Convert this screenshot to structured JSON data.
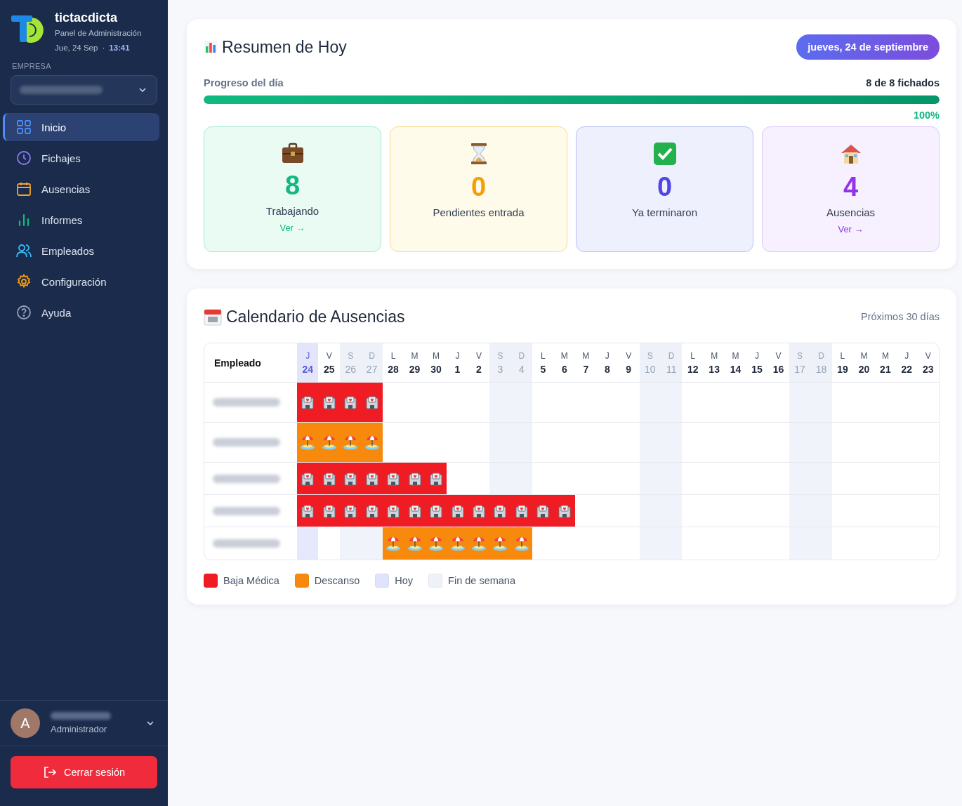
{
  "sidebar": {
    "brand": {
      "name": "tictacdicta",
      "subtitle": "Panel de Administración",
      "date": "Jue, 24 Sep",
      "separator": "·",
      "time": "13:41"
    },
    "company_label": "EMPRESA",
    "nav": [
      {
        "label": "Inicio",
        "selected": true
      },
      {
        "label": "Fichajes",
        "selected": false
      },
      {
        "label": "Ausencias",
        "selected": false
      },
      {
        "label": "Informes",
        "selected": false
      },
      {
        "label": "Empleados",
        "selected": false
      },
      {
        "label": "Configuración",
        "selected": false
      },
      {
        "label": "Ayuda",
        "selected": false
      }
    ],
    "user": {
      "initial": "A",
      "role": "Administrador"
    },
    "logout": "Cerrar sesión"
  },
  "summary": {
    "title": "Resumen de Hoy",
    "date_badge": "jueves, 24 de septiembre",
    "progress": {
      "label": "Progreso del día",
      "count": "8 de 8 fichados",
      "level": 1,
      "percent": "100%"
    },
    "cards": [
      {
        "kind": "working",
        "value": "8",
        "label": "Trabajando",
        "link": "Ver →"
      },
      {
        "kind": "pending",
        "value": "0",
        "label": "Pendientes entrada"
      },
      {
        "kind": "done",
        "value": "0",
        "label": "Ya terminaron"
      },
      {
        "kind": "absent",
        "value": "4",
        "label": "Ausencias",
        "link": "Ver →"
      }
    ]
  },
  "calendar": {
    "title": "Calendario de Ausencias",
    "subtitle": "Próximos 30 días",
    "employee_header": "Empleado",
    "days": [
      {
        "weekday": "J",
        "day": "24",
        "today": true,
        "weekend": false
      },
      {
        "weekday": "V",
        "day": "25",
        "today": false,
        "weekend": false
      },
      {
        "weekday": "S",
        "day": "26",
        "today": false,
        "weekend": true
      },
      {
        "weekday": "D",
        "day": "27",
        "today": false,
        "weekend": true
      },
      {
        "weekday": "L",
        "day": "28",
        "today": false,
        "weekend": false
      },
      {
        "weekday": "M",
        "day": "29",
        "today": false,
        "weekend": false
      },
      {
        "weekday": "M",
        "day": "30",
        "today": false,
        "weekend": false
      },
      {
        "weekday": "J",
        "day": "1",
        "today": false,
        "weekend": false
      },
      {
        "weekday": "V",
        "day": "2",
        "today": false,
        "weekend": false
      },
      {
        "weekday": "S",
        "day": "3",
        "today": false,
        "weekend": true
      },
      {
        "weekday": "D",
        "day": "4",
        "today": false,
        "weekend": true
      },
      {
        "weekday": "L",
        "day": "5",
        "today": false,
        "weekend": false
      },
      {
        "weekday": "M",
        "day": "6",
        "today": false,
        "weekend": false
      },
      {
        "weekday": "M",
        "day": "7",
        "today": false,
        "weekend": false
      },
      {
        "weekday": "J",
        "day": "8",
        "today": false,
        "weekend": false
      },
      {
        "weekday": "V",
        "day": "9",
        "today": false,
        "weekend": false
      },
      {
        "weekday": "S",
        "day": "10",
        "today": false,
        "weekend": true
      },
      {
        "weekday": "D",
        "day": "11",
        "today": false,
        "weekend": true
      },
      {
        "weekday": "L",
        "day": "12",
        "today": false,
        "weekend": false
      },
      {
        "weekday": "M",
        "day": "13",
        "today": false,
        "weekend": false
      },
      {
        "weekday": "M",
        "day": "14",
        "today": false,
        "weekend": false
      },
      {
        "weekday": "J",
        "day": "15",
        "today": false,
        "weekend": false
      },
      {
        "weekday": "V",
        "day": "16",
        "today": false,
        "weekend": false
      },
      {
        "weekday": "S",
        "day": "17",
        "today": false,
        "weekend": true
      },
      {
        "weekday": "D",
        "day": "18",
        "today": false,
        "weekend": true
      },
      {
        "weekday": "L",
        "day": "19",
        "today": false,
        "weekend": false
      },
      {
        "weekday": "M",
        "day": "20",
        "today": false,
        "weekend": false
      },
      {
        "weekday": "M",
        "day": "21",
        "today": false,
        "weekend": false
      },
      {
        "weekday": "J",
        "day": "22",
        "today": false,
        "weekend": false
      },
      {
        "weekday": "V",
        "day": "23",
        "today": false,
        "weekend": false
      }
    ],
    "rows": [
      {
        "cells": [
          {
            "kind": "sick"
          },
          {
            "kind": "sick"
          },
          {
            "kind": "sick"
          },
          {
            "kind": "sick"
          },
          {
            "kind": "none"
          },
          {
            "kind": "none"
          },
          {
            "kind": "none"
          },
          {
            "kind": "none"
          },
          {
            "kind": "none"
          },
          {
            "kind": "none"
          },
          {
            "kind": "none"
          },
          {
            "kind": "none"
          },
          {
            "kind": "none"
          },
          {
            "kind": "none"
          },
          {
            "kind": "none"
          },
          {
            "kind": "none"
          },
          {
            "kind": "none"
          },
          {
            "kind": "none"
          },
          {
            "kind": "none"
          },
          {
            "kind": "none"
          },
          {
            "kind": "none"
          },
          {
            "kind": "none"
          },
          {
            "kind": "none"
          },
          {
            "kind": "none"
          },
          {
            "kind": "none"
          },
          {
            "kind": "none"
          },
          {
            "kind": "none"
          },
          {
            "kind": "none"
          },
          {
            "kind": "none"
          },
          {
            "kind": "none"
          }
        ]
      },
      {
        "cells": [
          {
            "kind": "rest"
          },
          {
            "kind": "rest"
          },
          {
            "kind": "rest"
          },
          {
            "kind": "rest"
          },
          {
            "kind": "none"
          },
          {
            "kind": "none"
          },
          {
            "kind": "none"
          },
          {
            "kind": "none"
          },
          {
            "kind": "none"
          },
          {
            "kind": "none"
          },
          {
            "kind": "none"
          },
          {
            "kind": "none"
          },
          {
            "kind": "none"
          },
          {
            "kind": "none"
          },
          {
            "kind": "none"
          },
          {
            "kind": "none"
          },
          {
            "kind": "none"
          },
          {
            "kind": "none"
          },
          {
            "kind": "none"
          },
          {
            "kind": "none"
          },
          {
            "kind": "none"
          },
          {
            "kind": "none"
          },
          {
            "kind": "none"
          },
          {
            "kind": "none"
          },
          {
            "kind": "none"
          },
          {
            "kind": "none"
          },
          {
            "kind": "none"
          },
          {
            "kind": "none"
          },
          {
            "kind": "none"
          },
          {
            "kind": "none"
          }
        ]
      },
      {
        "cells": [
          {
            "kind": "sick"
          },
          {
            "kind": "sick"
          },
          {
            "kind": "sick"
          },
          {
            "kind": "sick"
          },
          {
            "kind": "sick"
          },
          {
            "kind": "sick"
          },
          {
            "kind": "sick"
          },
          {
            "kind": "none"
          },
          {
            "kind": "none"
          },
          {
            "kind": "none"
          },
          {
            "kind": "none"
          },
          {
            "kind": "none"
          },
          {
            "kind": "none"
          },
          {
            "kind": "none"
          },
          {
            "kind": "none"
          },
          {
            "kind": "none"
          },
          {
            "kind": "none"
          },
          {
            "kind": "none"
          },
          {
            "kind": "none"
          },
          {
            "kind": "none"
          },
          {
            "kind": "none"
          },
          {
            "kind": "none"
          },
          {
            "kind": "none"
          },
          {
            "kind": "none"
          },
          {
            "kind": "none"
          },
          {
            "kind": "none"
          },
          {
            "kind": "none"
          },
          {
            "kind": "none"
          },
          {
            "kind": "none"
          },
          {
            "kind": "none"
          }
        ]
      },
      {
        "cells": [
          {
            "kind": "sick"
          },
          {
            "kind": "sick"
          },
          {
            "kind": "sick"
          },
          {
            "kind": "sick"
          },
          {
            "kind": "sick"
          },
          {
            "kind": "sick"
          },
          {
            "kind": "sick"
          },
          {
            "kind": "sick"
          },
          {
            "kind": "sick"
          },
          {
            "kind": "sick"
          },
          {
            "kind": "sick"
          },
          {
            "kind": "sick"
          },
          {
            "kind": "sick"
          },
          {
            "kind": "none"
          },
          {
            "kind": "none"
          },
          {
            "kind": "none"
          },
          {
            "kind": "none"
          },
          {
            "kind": "none"
          },
          {
            "kind": "none"
          },
          {
            "kind": "none"
          },
          {
            "kind": "none"
          },
          {
            "kind": "none"
          },
          {
            "kind": "none"
          },
          {
            "kind": "none"
          },
          {
            "kind": "none"
          },
          {
            "kind": "none"
          },
          {
            "kind": "none"
          },
          {
            "kind": "none"
          },
          {
            "kind": "none"
          },
          {
            "kind": "none"
          }
        ]
      },
      {
        "cells": [
          {
            "kind": "none"
          },
          {
            "kind": "none"
          },
          {
            "kind": "none"
          },
          {
            "kind": "none"
          },
          {
            "kind": "rest"
          },
          {
            "kind": "rest"
          },
          {
            "kind": "rest"
          },
          {
            "kind": "rest"
          },
          {
            "kind": "rest"
          },
          {
            "kind": "rest"
          },
          {
            "kind": "rest"
          },
          {
            "kind": "none"
          },
          {
            "kind": "none"
          },
          {
            "kind": "none"
          },
          {
            "kind": "none"
          },
          {
            "kind": "none"
          },
          {
            "kind": "none"
          },
          {
            "kind": "none"
          },
          {
            "kind": "none"
          },
          {
            "kind": "none"
          },
          {
            "kind": "none"
          },
          {
            "kind": "none"
          },
          {
            "kind": "none"
          },
          {
            "kind": "none"
          },
          {
            "kind": "none"
          },
          {
            "kind": "none"
          },
          {
            "kind": "none"
          },
          {
            "kind": "none"
          },
          {
            "kind": "none"
          },
          {
            "kind": "none"
          }
        ]
      }
    ],
    "legend": [
      {
        "label": "Baja Médica",
        "color": "#ef1c24"
      },
      {
        "label": "Descanso",
        "color": "#f7890c"
      },
      {
        "label": "Hoy",
        "color": "#e0e4fb"
      },
      {
        "label": "Fin de semana",
        "color": "#eef1f8"
      }
    ]
  }
}
